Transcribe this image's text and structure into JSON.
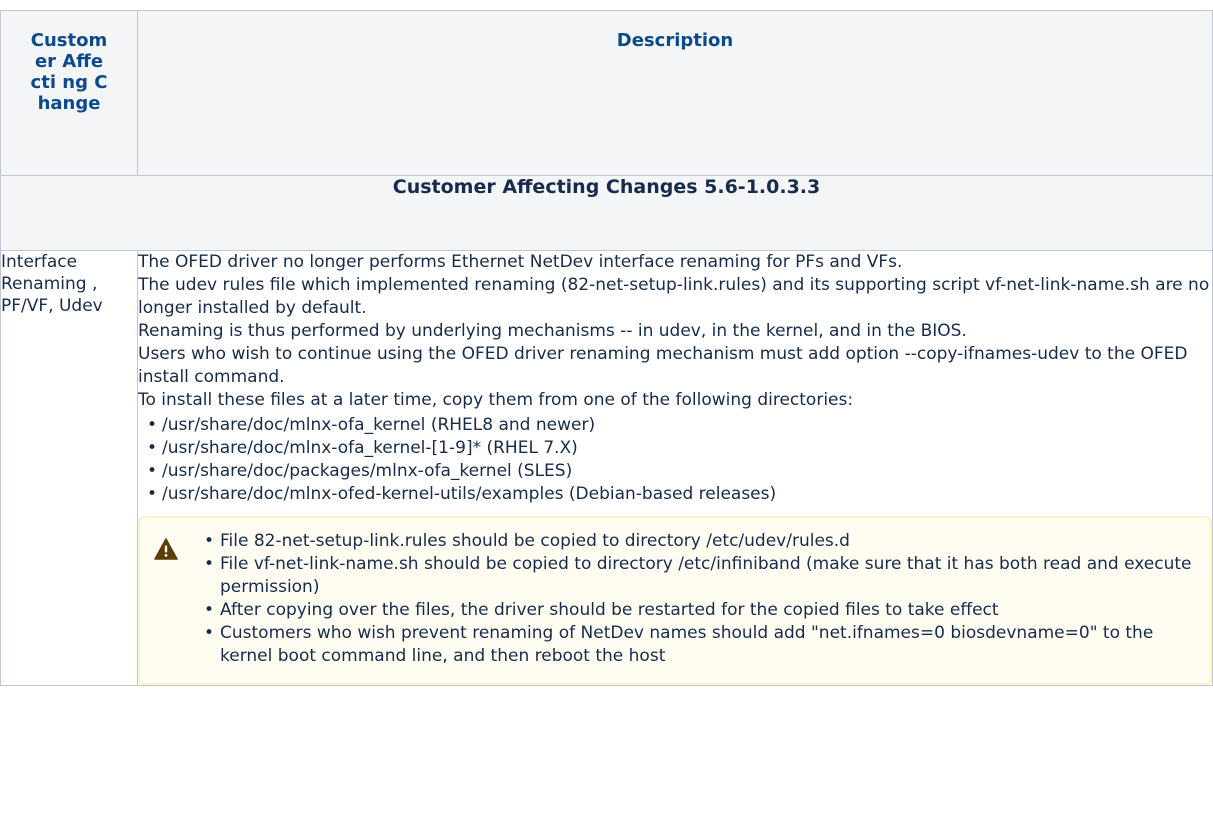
{
  "header": {
    "col1": "Custom er Affecti ng Change",
    "col2": "Description"
  },
  "section_title": "Customer Affecting Changes 5.6-1.0.3.3",
  "row": {
    "change": "Interface Renaming , PF/VF, Udev",
    "paragraphs": [
      "The OFED driver no longer performs Ethernet NetDev interface renaming for PFs and VFs.",
      "The udev rules file which implemented renaming (82-net-setup-link.rules) and its supporting script vf-net-link-name.sh are no longer installed by default.",
      "Renaming is thus performed by underlying mechanisms -- in udev, in the kernel, and in the BIOS.",
      "Users who wish to continue using the OFED driver renaming mechanism must add option --copy-ifnames-udev to the OFED install command.",
      "To install these files at a later time, copy them from one of the following directories:"
    ],
    "directories": [
      "/usr/share/doc/mlnx-ofa_kernel (RHEL8 and newer)",
      "/usr/share/doc/mlnx-ofa_kernel-[1-9]* (RHEL 7.X)",
      "/usr/share/doc/packages/mlnx-ofa_kernel (SLES)",
      "/usr/share/doc/mlnx-ofed-kernel-utils/examples (Debian-based releases)"
    ],
    "note": {
      "icon": "warning-icon",
      "items": [
        "File 82-net-setup-link.rules should be copied to directory /etc/udev/rules.d",
        "File vf-net-link-name.sh should be copied to directory /etc/infiniband (make sure that it has both read and execute permission)",
        "After copying over the files, the driver should be restarted for the copied files to take effect",
        "Customers who wish prevent renaming of NetDev names should add \"net.ifnames=0 biosdevname=0\" to the kernel boot command line, and then reboot the host"
      ]
    }
  },
  "colors": {
    "header_text": "#0b4a8c",
    "header_bg": "#f4f5f7",
    "border": "#c1c7d0",
    "note_bg": "#fffdf2",
    "note_border": "#fdf1c8",
    "warning_icon": "#5a3d0a"
  }
}
